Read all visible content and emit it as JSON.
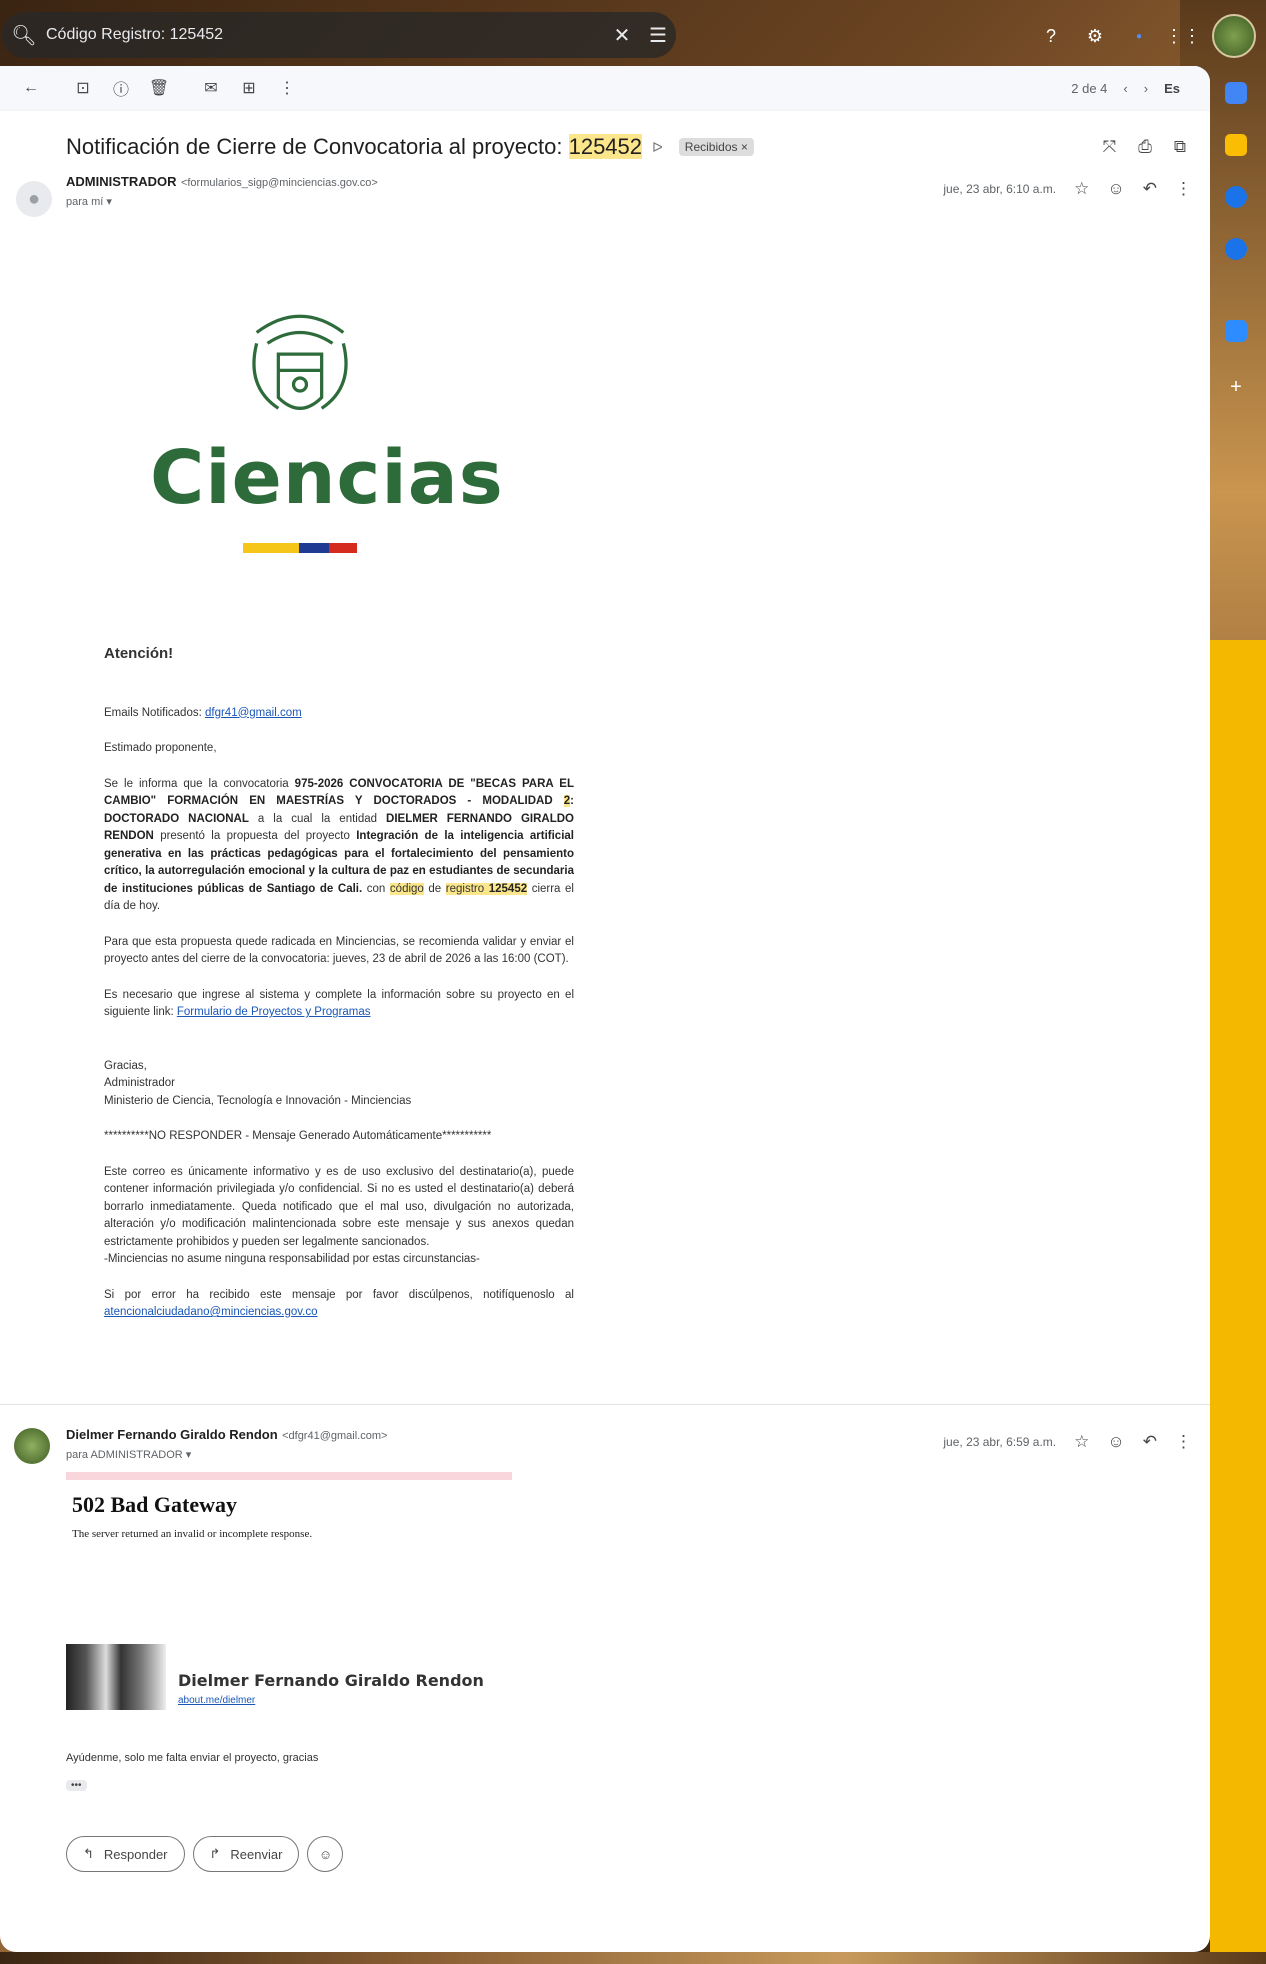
{
  "search": {
    "query": "Código Registro: 125452"
  },
  "toolbar": {
    "pager": "2 de 4",
    "lang": "Es"
  },
  "subject": {
    "prefix": "Notificación de Cierre de Convocatoria al proyecto: ",
    "code": "125452",
    "label": "Recibidos ×"
  },
  "message1": {
    "sender": "ADMINISTRADOR",
    "email": "<formularios_sigp@minciencias.gov.co>",
    "to": "para mí",
    "date": "jue, 23 abr, 6:10 a.m."
  },
  "logo": {
    "word": "Ciencias"
  },
  "body": {
    "atencion": "Atención!",
    "emails_label": "Emails Notificados: ",
    "emails_value": "dfgr41@gmail.com",
    "greeting": "Estimado proponente,",
    "p1_a": "Se le informa que la convocatoria ",
    "p1_b": "975-2026 CONVOCATORIA DE \"BECAS PARA EL CAMBIO\" FORMACIÓN EN MAESTRÍAS Y DOCTORADOS - MODALIDAD ",
    "p1_c": "2",
    "p1_d": ": DOCTORADO NACIONAL",
    "p1_e": " a la cual la entidad ",
    "p1_f": "DIELMER FERNANDO GIRALDO RENDON",
    "p1_g": " presentó la propuesta del proyecto ",
    "p1_h": "Integración de la inteligencia artificial generativa en las prácticas pedagógicas para el fortalecimiento del pensamiento crítico, la autorregulación emocional y la cultura de paz en estudiantes de secundaria de instituciones públicas de Santiago de Cali.",
    "p1_i": " con ",
    "p1_j": "código",
    "p1_k": " de ",
    "p1_l": "registro",
    "p1_m": " ",
    "p1_n": "125452",
    "p1_o": " cierra el día de hoy.",
    "p2": "Para que esta propuesta quede radicada en Minciencias, se recomienda validar y enviar el proyecto antes del cierre de la convocatoria: jueves, 23 de abril de 2026 a las 16:00 (COT).",
    "p3_a": "Es necesario que ingrese al sistema y complete la información sobre su proyecto en el siguiente link: ",
    "p3_link": "Formulario de Proyectos y Programas",
    "thanks": "Gracias,",
    "sig1": "Administrador",
    "sig2": "Ministerio de Ciencia, Tecnología e Innovación - Minciencias",
    "noreply": "**********NO RESPONDER - Mensaje Generado Automáticamente***********",
    "disclaimer": "Este correo es únicamente informativo y es de uso exclusivo del destinatario(a), puede contener información privilegiada y/o confidencial. Si no es usted el destinatario(a) deberá borrarlo inmediatamente. Queda notificado que el mal uso, divulgación no autorizada, alteración y/o modificación malintencionada sobre este mensaje y sus anexos quedan estrictamente prohibidos y pueden ser legalmente sancionados.",
    "disclaimer2": "-Minciencias no asume ninguna responsabilidad por estas circunstancias-",
    "error_a": "Si por error ha recibido este mensaje por favor discúlpenos, notifíquenoslo al ",
    "error_link": "atencionalciudadano@minciencias.gov.co"
  },
  "message2": {
    "sender": "Dielmer Fernando Giraldo Rendon",
    "email": "<dfgr41@gmail.com>",
    "to": "para ADMINISTRADOR",
    "date": "jue, 23 abr, 6:59 a.m.",
    "error_title": "502 Bad Gateway",
    "error_sub": "The server returned an invalid or incomplete response.",
    "sig_name": "Dielmer Fernando Giraldo Rendon",
    "sig_link": "about.me/dielmer",
    "text": "Ayúdenme, solo me falta enviar el proyecto, gracias",
    "dots": "•••"
  },
  "actions": {
    "reply": "Responder",
    "forward": "Reenviar"
  },
  "colors": {
    "accent_yellow": "#f5b800",
    "logo_green": "#2e6b3a",
    "highlight": "#fce68b"
  }
}
